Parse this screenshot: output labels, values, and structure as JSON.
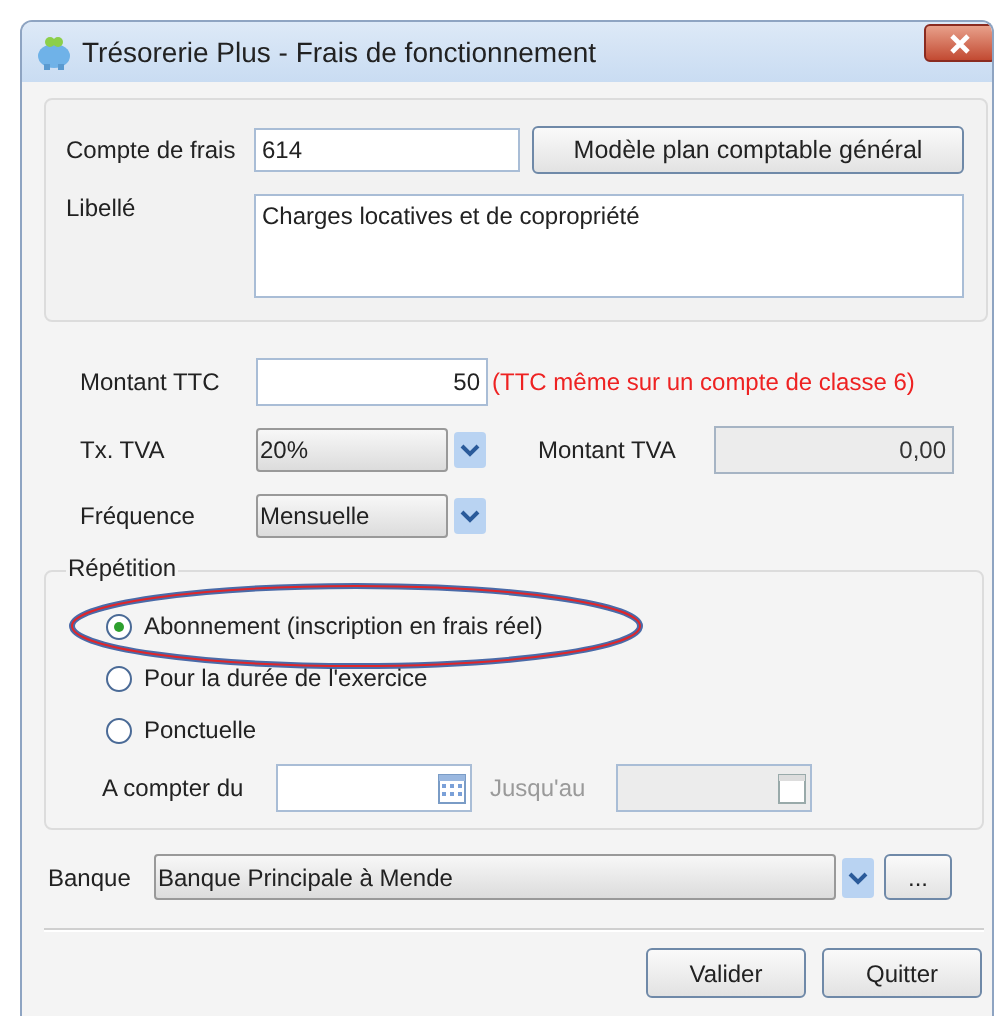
{
  "window": {
    "title": "Trésorerie Plus - Frais de fonctionnement"
  },
  "compte": {
    "label": "Compte de frais",
    "value": "614"
  },
  "model_button": "Modèle plan comptable général",
  "libelle": {
    "label": "Libellé",
    "value": "Charges locatives et de copropriété"
  },
  "montant_ttc": {
    "label": "Montant TTC",
    "value": "50",
    "note": "(TTC même sur un compte de classe 6)"
  },
  "tva": {
    "label": "Tx. TVA",
    "value": "20%"
  },
  "montant_tva": {
    "label": "Montant TVA",
    "value": "0,00",
    "disabled": true
  },
  "frequence": {
    "label": "Fréquence",
    "value": "Mensuelle"
  },
  "repetition": {
    "title": "Répétition",
    "options": [
      {
        "label": "Abonnement (inscription en frais réel)",
        "selected": true,
        "circled": true
      },
      {
        "label": "Pour la durée de l'exercice",
        "selected": false,
        "circled": false
      },
      {
        "label": "Ponctuelle",
        "selected": false,
        "circled": false
      }
    ]
  },
  "date_from": {
    "label": "A compter du",
    "disabled": false
  },
  "date_to": {
    "label": "Jusqu'au",
    "disabled": true
  },
  "banque": {
    "label": "Banque",
    "value": "Banque Principale à Mende",
    "more_button": "..."
  },
  "buttons": [
    "Valider",
    "Quitter"
  ]
}
